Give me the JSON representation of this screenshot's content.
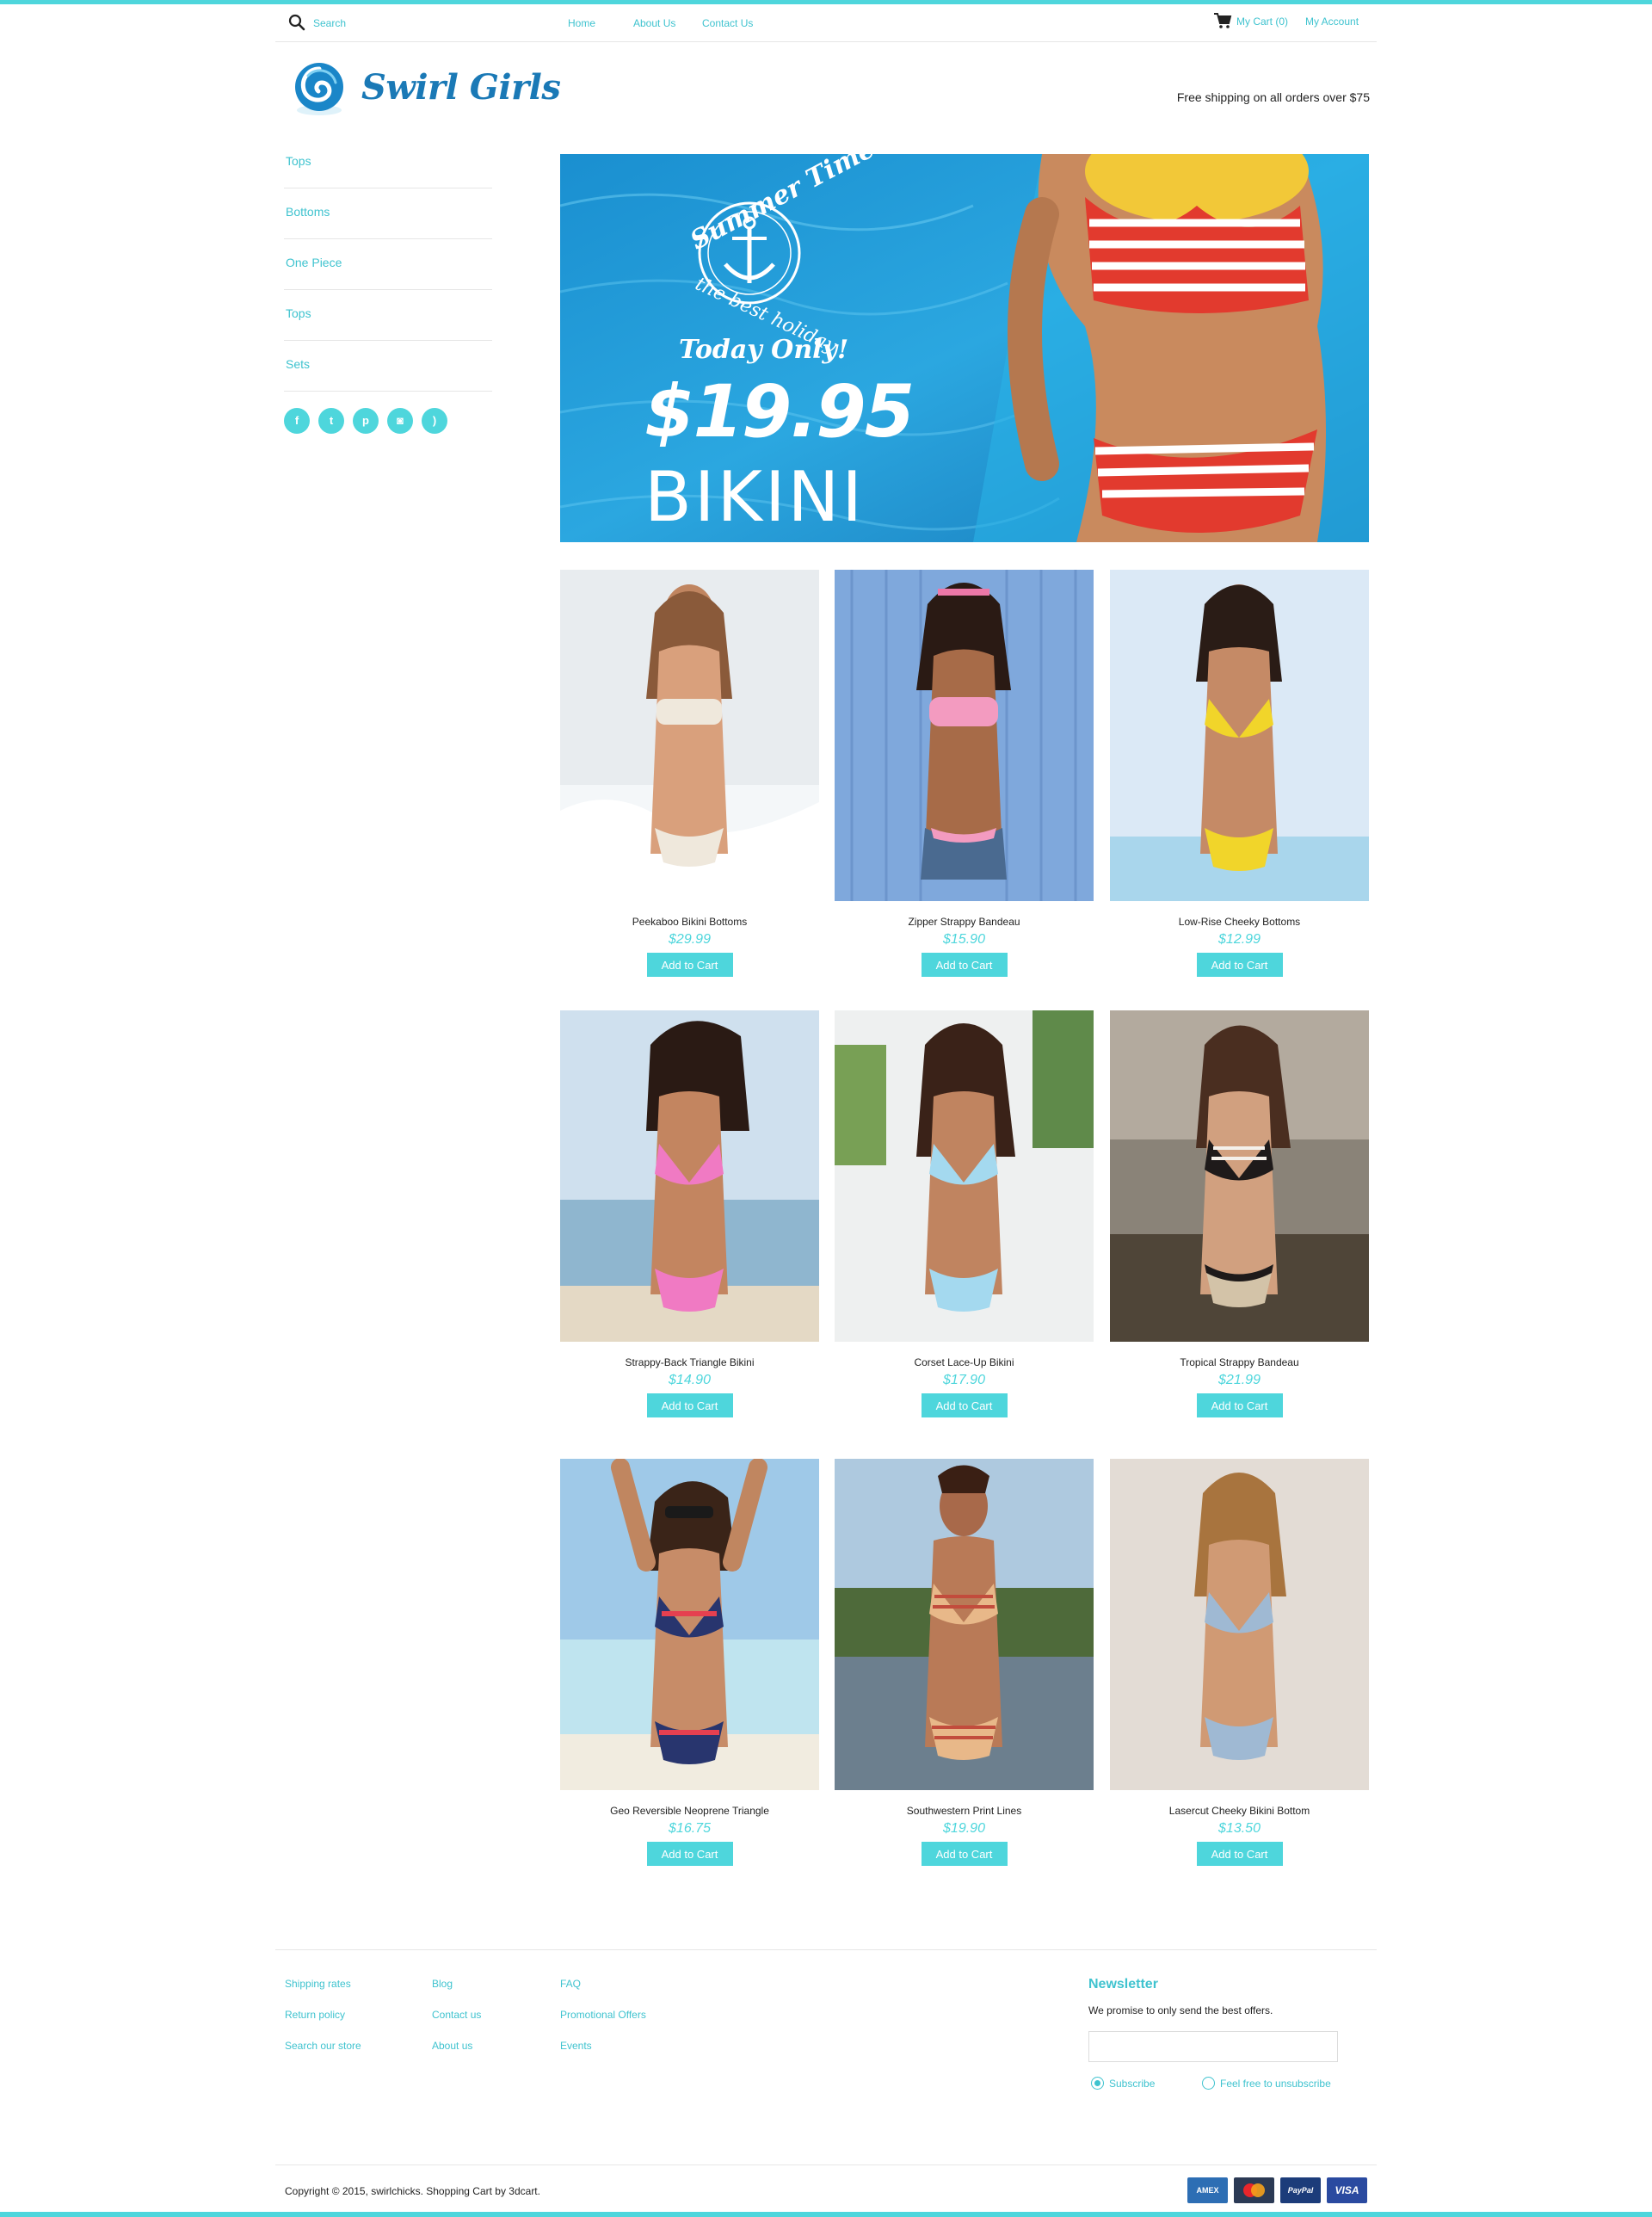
{
  "header": {
    "search_placeholder": "Search",
    "nav": [
      "Home",
      "About Us",
      "Contact Us"
    ],
    "cart_label": "My Cart (0)",
    "account_label": "My Account"
  },
  "brand": {
    "name": "Swirl Girls",
    "shipping_note": "Free shipping on all orders over $75"
  },
  "sidebar": {
    "categories": [
      "Tops",
      "Bottoms",
      "One Piece",
      "Tops",
      "Sets"
    ],
    "social": [
      "facebook-icon",
      "twitter-icon",
      "pinterest-icon",
      "instagram-icon",
      "rss-icon"
    ]
  },
  "banner": {
    "headline": "Summer Time",
    "tagline": "the best holiday",
    "promo": "Today Only!",
    "price": "$19.95",
    "item": "BIKINI"
  },
  "products": [
    {
      "name": "Peekaboo Bikini Bottoms",
      "price": "$29.99",
      "button": "Add to Cart"
    },
    {
      "name": "Zipper Strappy Bandeau",
      "price": "$15.90",
      "button": "Add to Cart"
    },
    {
      "name": "Low-Rise Cheeky Bottoms",
      "price": "$12.99",
      "button": "Add to Cart"
    },
    {
      "name": "Strappy-Back Triangle Bikini",
      "price": "$14.90",
      "button": "Add to Cart"
    },
    {
      "name": "Corset Lace-Up Bikini",
      "price": "$17.90",
      "button": "Add to Cart"
    },
    {
      "name": "Tropical Strappy Bandeau",
      "price": "$21.99",
      "button": "Add to Cart"
    },
    {
      "name": "Geo Reversible Neoprene Triangle",
      "price": "$16.75",
      "button": "Add to Cart"
    },
    {
      "name": "Southwestern Print Lines",
      "price": "$19.90",
      "button": "Add to Cart"
    },
    {
      "name": "Lasercut Cheeky Bikini Bottom",
      "price": "$13.50",
      "button": "Add to Cart"
    }
  ],
  "footer": {
    "col1": [
      "Shipping rates",
      "Return policy",
      "Search our store"
    ],
    "col2": [
      "Blog",
      "Contact us",
      "About us"
    ],
    "col3": [
      "FAQ",
      "Promotional Offers",
      "Events"
    ],
    "newsletter": {
      "title": "Newsletter",
      "text": "We promise to only send  the best offers.",
      "subscribe": "Subscribe",
      "unsubscribe": "Feel free to unsubscribe",
      "selected": "Subscribe"
    },
    "copyright": "Copyright © 2015, swirlchicks. Shopping Cart by 3dcart.",
    "payments": [
      "AMEX",
      "MC",
      "PayPal",
      "VISA"
    ]
  },
  "colors": {
    "accent": "#4ed6dc",
    "link": "#3fc3cf",
    "brand": "#1a79b6",
    "amex": "#2d6eb4",
    "mastercard": "#2b3a55",
    "paypal": "#1c3c7a",
    "visa": "#2a4aa0"
  }
}
